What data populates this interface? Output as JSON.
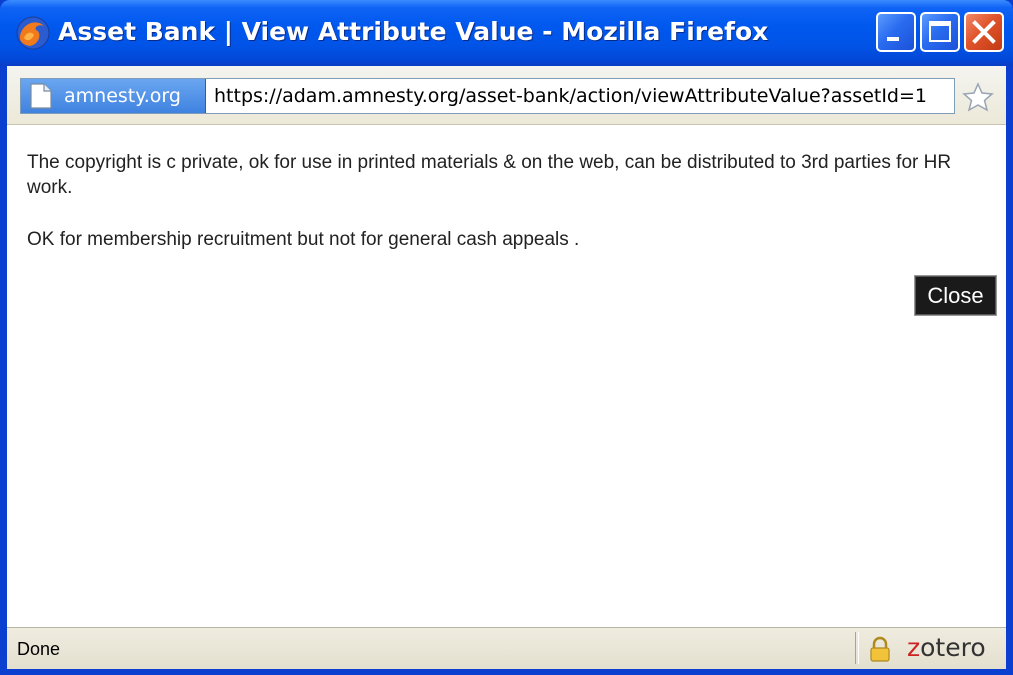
{
  "window": {
    "title": "Asset Bank | View Attribute Value - Mozilla Firefox",
    "icon": "firefox-icon",
    "controls": [
      "minimize-icon",
      "maximize-icon",
      "close-icon"
    ]
  },
  "address_bar": {
    "site_identity": "amnesty.org",
    "url": "https://adam.amnesty.org/asset-bank/action/viewAttributeValue?assetId=1",
    "page_icon": "page-icon",
    "bookmark_icon": "star-icon"
  },
  "content": {
    "paragraph_1": "The copyright is c private, ok for use in printed materials & on the web, can be distributed to 3rd parties for HR work.",
    "paragraph_2": "OK for membership recruitment but not for general cash appeals .",
    "close_label": "Close"
  },
  "status_bar": {
    "status": "Done",
    "lock_icon": "lock-icon",
    "zotero_z": "z",
    "zotero_rest": "otero"
  },
  "colors": {
    "titlebar": "#0058ee",
    "close_button_bg": "#1a1a1a",
    "site_badge": "#3f82e0"
  }
}
